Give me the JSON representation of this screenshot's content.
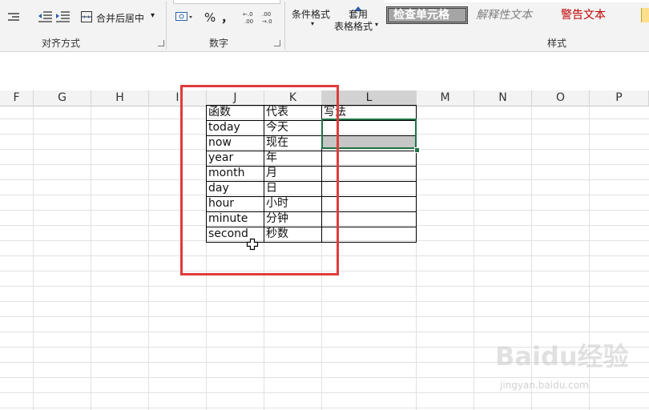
{
  "ribbon": {
    "merge_center_label": "合并后居中",
    "merge_dropdown_symbol": "▾",
    "alignment_group_label": "对齐方式",
    "number_group_label": "数字",
    "styles_group_label": "样式",
    "percent_symbol": "%",
    "comma_symbol": "，",
    "conditional_format_label": "条件格式",
    "table_format_label_line1": "套用",
    "table_format_label_line2": "表格格式",
    "style_check_cell": "检查单元格",
    "style_explanatory": "解释性文本",
    "style_warning": "警告文本"
  },
  "columns": [
    "F",
    "G",
    "H",
    "I",
    "J",
    "K",
    "L",
    "M",
    "N",
    "O",
    "P"
  ],
  "selected_column": "L",
  "table": {
    "headers": [
      "函数",
      "代表",
      "写法"
    ],
    "rows": [
      [
        "today",
        "今天"
      ],
      [
        "now",
        "现在"
      ],
      [
        "year",
        "年"
      ],
      [
        "month",
        "月"
      ],
      [
        "day",
        "日"
      ],
      [
        "hour",
        "小时"
      ],
      [
        "minute",
        "分钟"
      ],
      [
        "second",
        "秒数"
      ]
    ]
  },
  "watermark": {
    "main": "Baidu经验",
    "sub": "jingyan.baidu.com"
  },
  "colors": {
    "selection_border": "#217346",
    "highlight_rect": "#e03b3b",
    "warning_text": "#c00000"
  }
}
